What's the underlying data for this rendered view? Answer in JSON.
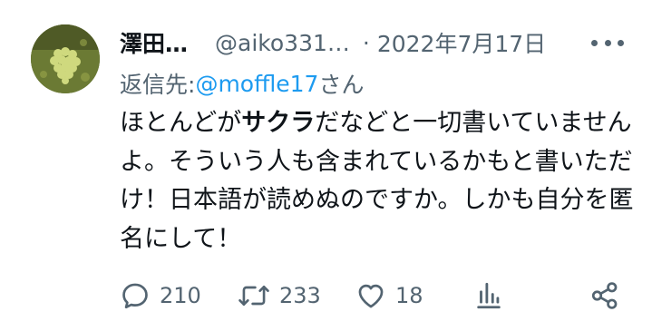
{
  "tweet": {
    "author_name": "澤田…",
    "handle": "@aiko331…",
    "separator": "·",
    "date": "2022年7月17日",
    "reply_label": "返信先: ",
    "reply_mention": "@moffle17",
    "reply_suffix": "さん",
    "text_pre": "ほとんどが",
    "text_bold": "サクラ",
    "text_post": "だなどと一切書いていませんよ。そういう人も含まれているかもと書いただけ！日本語が読めぬのですか。しかも自分を匿名にして！"
  },
  "actions": {
    "replies": "210",
    "retweets": "233",
    "likes": "18"
  },
  "icons": {
    "avatar": "avatar-image",
    "more": "more-icon",
    "reply": "reply-icon",
    "retweet": "retweet-icon",
    "like": "heart-icon",
    "analytics": "analytics-icon",
    "share": "share-icon"
  },
  "colors": {
    "text": "#0f1419",
    "secondary": "#536471",
    "link": "#1d9bf0"
  }
}
